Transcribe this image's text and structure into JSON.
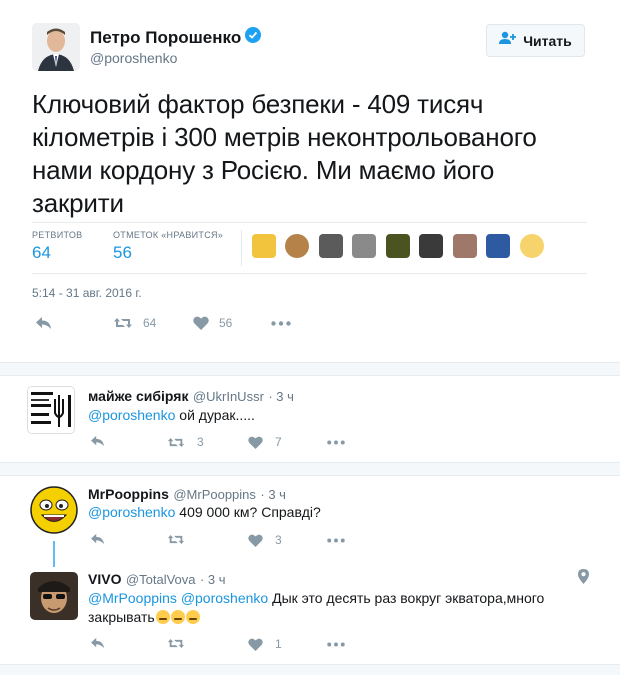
{
  "tweet": {
    "author_name": "Петро Порошенко",
    "author_handle": "@poroshenko",
    "follow_label": "Читать",
    "text": "Ключовий фактор безпеки - 409 тисяч кілометрів і 300 метрів неконтрольованого нами кордону з Росією. Ми маємо його закрити",
    "retweets_label": "РЕТВИТОВ",
    "retweets_count": "64",
    "likes_label": "ОТМЕТОК «НРАВИТСЯ»",
    "likes_count": "56",
    "timestamp": "5:14 - 31 авг. 2016 г.",
    "action_retweet_count": "64",
    "action_like_count": "56"
  },
  "replies": [
    {
      "name": "майже сибіряк",
      "handle": "@UkrInUssr",
      "time": "· 3 ч",
      "mention": "@poroshenko",
      "text": " ой дурак.....",
      "retweets": "3",
      "likes": "7",
      "avatar_text": "АЙДАН НЕ ВО ЖИЗ ГРАНИЦА ТЕРПЬ В ССКИЙ"
    },
    {
      "name": "MrPooppins",
      "handle": "@MrPooppins",
      "time": "· 3 ч",
      "mention": "@poroshenko",
      "text": " 409 000 км? Справді?",
      "retweets": "",
      "likes": "3"
    },
    {
      "name": "VIVO",
      "handle": "@TotalVova",
      "time": "· 3 ч",
      "mention1": "@MrPooppins",
      "mention2": "@poroshenko",
      "text": " Дык это десять раз вокруг экватора,много закрывать",
      "retweets": "",
      "likes": "1"
    }
  ],
  "icons": [
    "verified-badge-icon",
    "follow-user-icon",
    "reply-icon",
    "retweet-icon",
    "like-icon",
    "more-icon",
    "location-pin-icon"
  ],
  "colors": {
    "link": "#1b95e0",
    "verified": "#1da1f2",
    "muted": "#657786"
  }
}
